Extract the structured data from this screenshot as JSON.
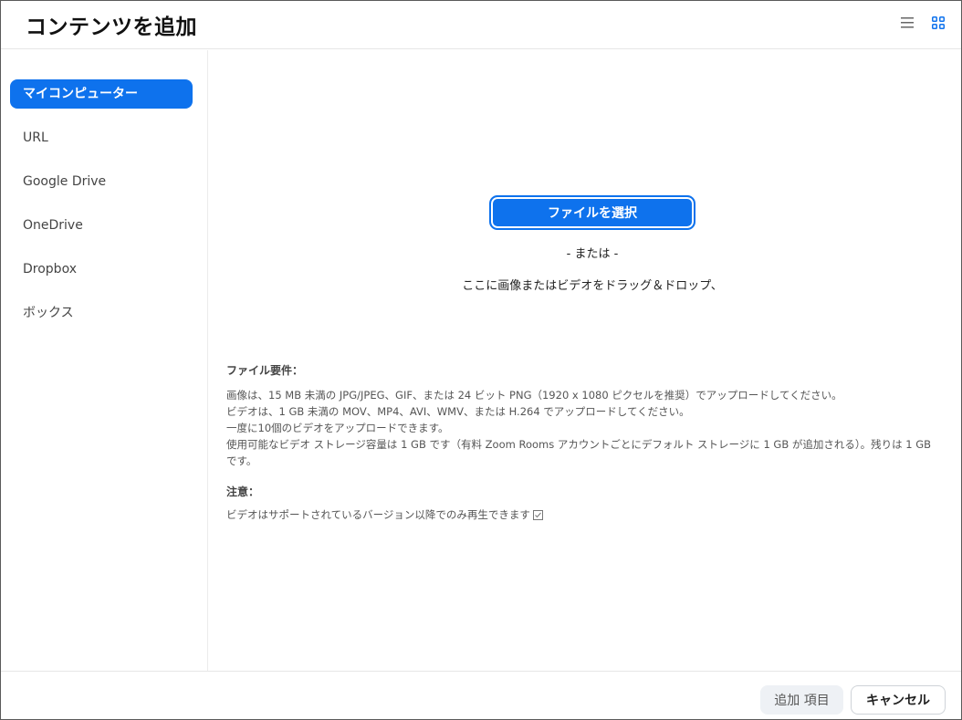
{
  "window": {
    "title": "コンテンツを追加"
  },
  "icons": {
    "list_view": "list-view-icon",
    "grid_view": "grid-view-icon",
    "play_check": "checkbox-icon"
  },
  "colors": {
    "accent": "#0e72ed",
    "accent_text": "#ffffff"
  },
  "sidebar": {
    "items": [
      {
        "label": "マイコンピューター",
        "active": true
      },
      {
        "label": "URL",
        "active": false
      },
      {
        "label": "Google Drive",
        "active": false
      },
      {
        "label": "OneDrive",
        "active": false
      },
      {
        "label": "Dropbox",
        "active": false
      },
      {
        "label": "ボックス",
        "active": false
      }
    ]
  },
  "main": {
    "choose_file_label": "ファイルを選択",
    "or_text": "- または -",
    "drop_text": "ここに画像またはビデオをドラッグ＆ドロップ、",
    "requirements_title": "ファイル要件：",
    "requirements": [
      "画像は、15 MB 未満の JPG/JPEG、GIF、または 24 ビット PNG（1920 x 1080 ピクセルを推奨）でアップロードしてください。",
      "ビデオは、1 GB 未満の MOV、MP4、AVI、WMV、または H.264 でアップロードしてください。",
      "一度に10個のビデオをアップロードできます。",
      "使用可能なビデオ ストレージ容量は 1 GB です（有料 Zoom Rooms アカウントごとにデフォルト ストレージに 1 GB が追加される）。残りは 1 GB",
      "です。"
    ],
    "note_title": "注意：",
    "note_text": "ビデオはサポートされているバージョン以降でのみ再生できます"
  },
  "footer": {
    "add_label": "追加 項目",
    "cancel_label": "キャンセル"
  }
}
